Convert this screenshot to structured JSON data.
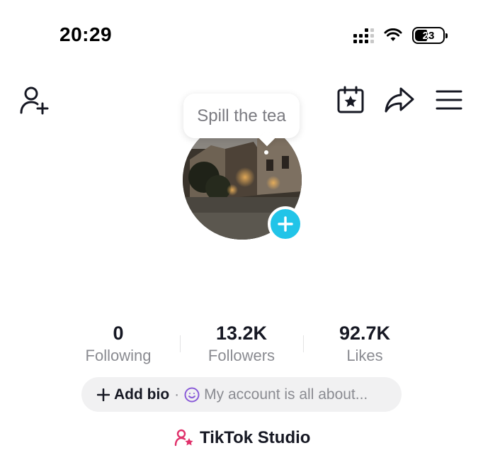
{
  "status_bar": {
    "time": "20:29",
    "battery": "23"
  },
  "tooltip": {
    "text": "Spill the tea"
  },
  "stats": [
    {
      "value": "0",
      "label": "Following"
    },
    {
      "value": "13.2K",
      "label": "Followers"
    },
    {
      "value": "92.7K",
      "label": "Likes"
    }
  ],
  "bio": {
    "add_label": "Add bio",
    "separator": "·",
    "placeholder": "My account is all about..."
  },
  "studio": {
    "label": "TikTok Studio"
  },
  "icons": {
    "add_friend": "add-friend-icon",
    "calendar": "calendar-star-icon",
    "share": "share-arrow-icon",
    "menu": "hamburger-menu-icon",
    "avatar_add": "plus-icon",
    "bio_add": "plus-icon",
    "bio_emoji": "smiley-icon",
    "studio": "creator-star-icon"
  },
  "colors": {
    "accent_cyan": "#21c4e8",
    "studio_pink": "#e0306a",
    "bio_emoji_purple": "#8a5cd8"
  }
}
